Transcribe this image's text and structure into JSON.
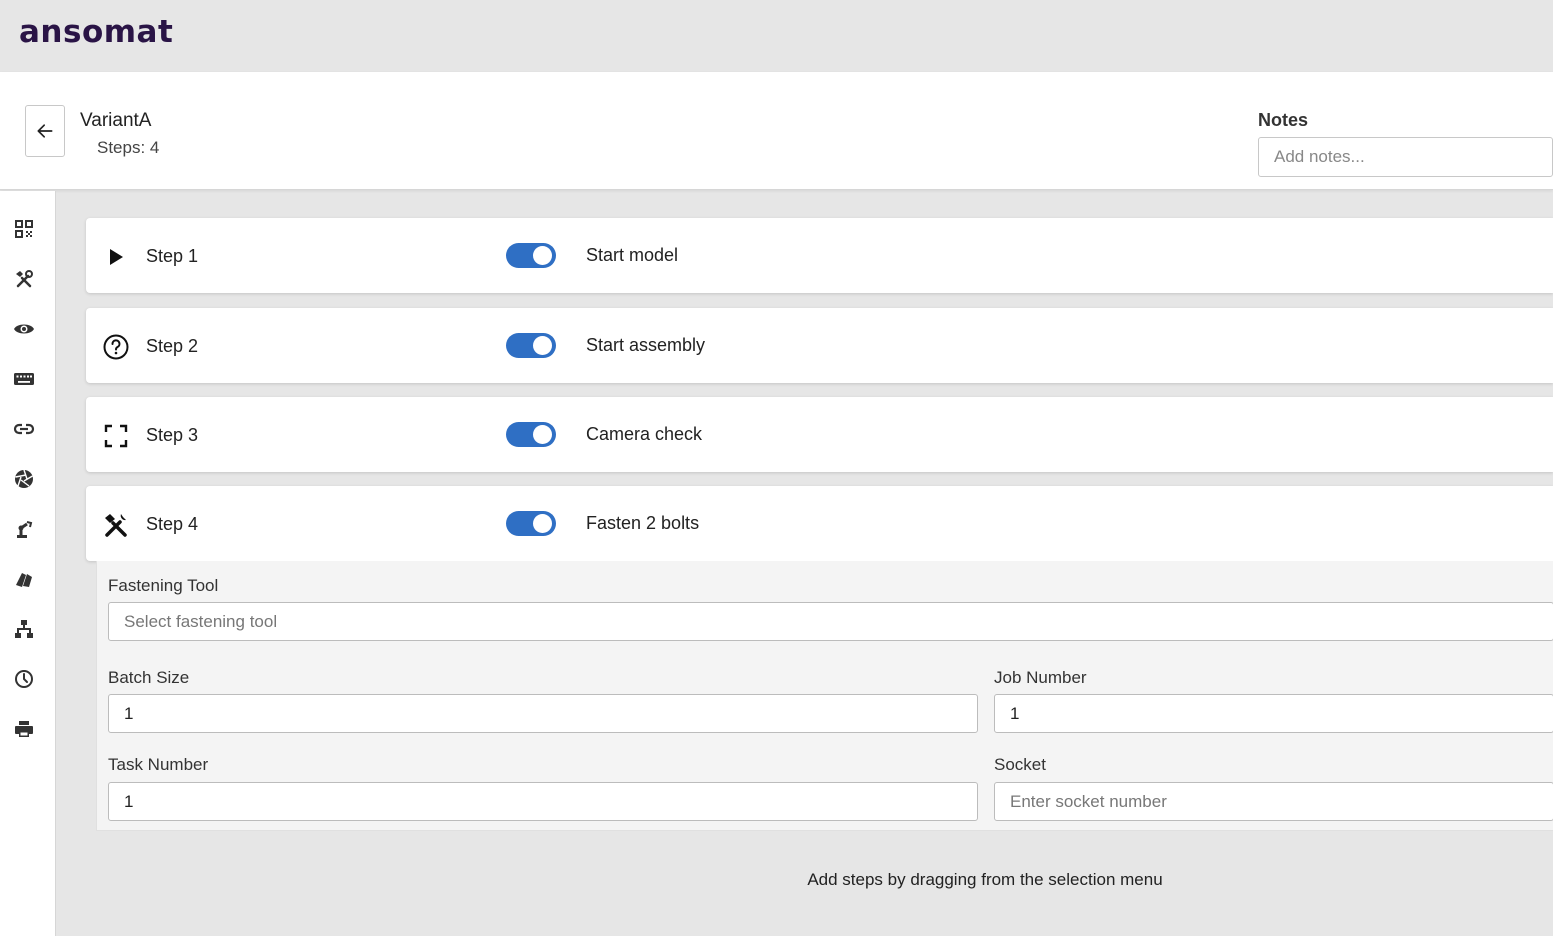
{
  "app": {
    "logo": "ansomat"
  },
  "header": {
    "variant_name": "VariantA",
    "steps_count": "Steps: 4",
    "notes_label": "Notes",
    "notes_placeholder": "Add notes..."
  },
  "sidebar": {
    "icons": [
      "qr-code-icon",
      "tools-icon",
      "eye-icon",
      "keyboard-icon",
      "link-icon",
      "aperture-icon",
      "robot-arm-icon",
      "parts-icon",
      "hierarchy-icon",
      "clock-icon",
      "printer-icon"
    ]
  },
  "steps": [
    {
      "label": "Step 1",
      "description": "Start model",
      "icon": "play-icon",
      "enabled": true
    },
    {
      "label": "Step 2",
      "description": "Start assembly",
      "icon": "question-circle-icon",
      "enabled": true
    },
    {
      "label": "Step 3",
      "description": "Camera check",
      "icon": "frame-corners-icon",
      "enabled": true
    },
    {
      "label": "Step 4",
      "description": "Fasten 2 bolts",
      "icon": "hammer-wrench-icon",
      "enabled": true
    }
  ],
  "step4_details": {
    "fastening_tool_label": "Fastening Tool",
    "fastening_tool_placeholder": "Select fastening tool",
    "batch_size_label": "Batch Size",
    "batch_size_value": "1",
    "job_number_label": "Job Number",
    "job_number_value": "1",
    "task_number_label": "Task Number",
    "task_number_value": "1",
    "socket_label": "Socket",
    "socket_placeholder": "Enter socket number"
  },
  "hint": "Add steps by dragging from the selection menu",
  "colors": {
    "accent": "#2f6fc4",
    "logo": "#2a1446"
  }
}
